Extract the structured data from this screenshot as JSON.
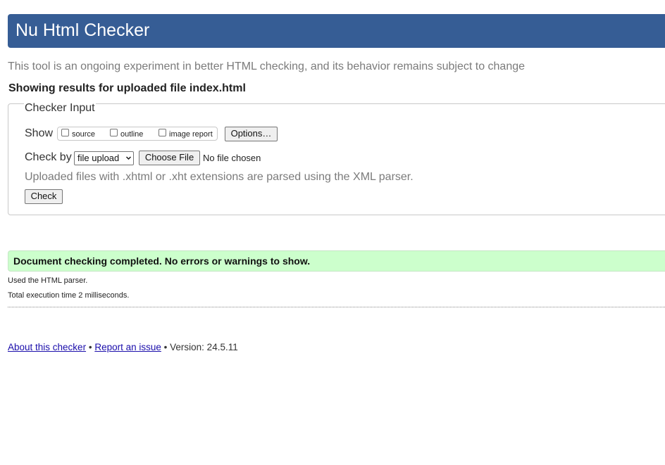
{
  "header": {
    "title": "Nu Html Checker"
  },
  "intro": "This tool is an ongoing experiment in better HTML checking, and its behavior remains subject to change",
  "showing_results": "Showing results for uploaded file index.html",
  "checker_input": {
    "legend": "Checker Input",
    "show_label": "Show",
    "options": [
      {
        "label": "source",
        "checked": false
      },
      {
        "label": "outline",
        "checked": false
      },
      {
        "label": "image report",
        "checked": false
      }
    ],
    "options_button": "Options…",
    "check_by_label": "Check by",
    "check_by_selected": "file upload",
    "choose_file_button": "Choose File",
    "no_file_text": "No file chosen",
    "xml_note": "Uploaded files with .xhtml or .xht extensions are parsed using the XML parser.",
    "check_button": "Check"
  },
  "result": {
    "success_message": "Document checking completed. No errors or warnings to show.",
    "parser_note": "Used the HTML parser.",
    "execution_time": "Total execution time 2 milliseconds."
  },
  "footer": {
    "about_link": "About this checker",
    "separator": "•",
    "report_link": "Report an issue",
    "version": "Version: 24.5.11"
  },
  "colors": {
    "header_bg": "#365d95",
    "success_bg": "#ccffcc",
    "link": "#1a0dab"
  }
}
